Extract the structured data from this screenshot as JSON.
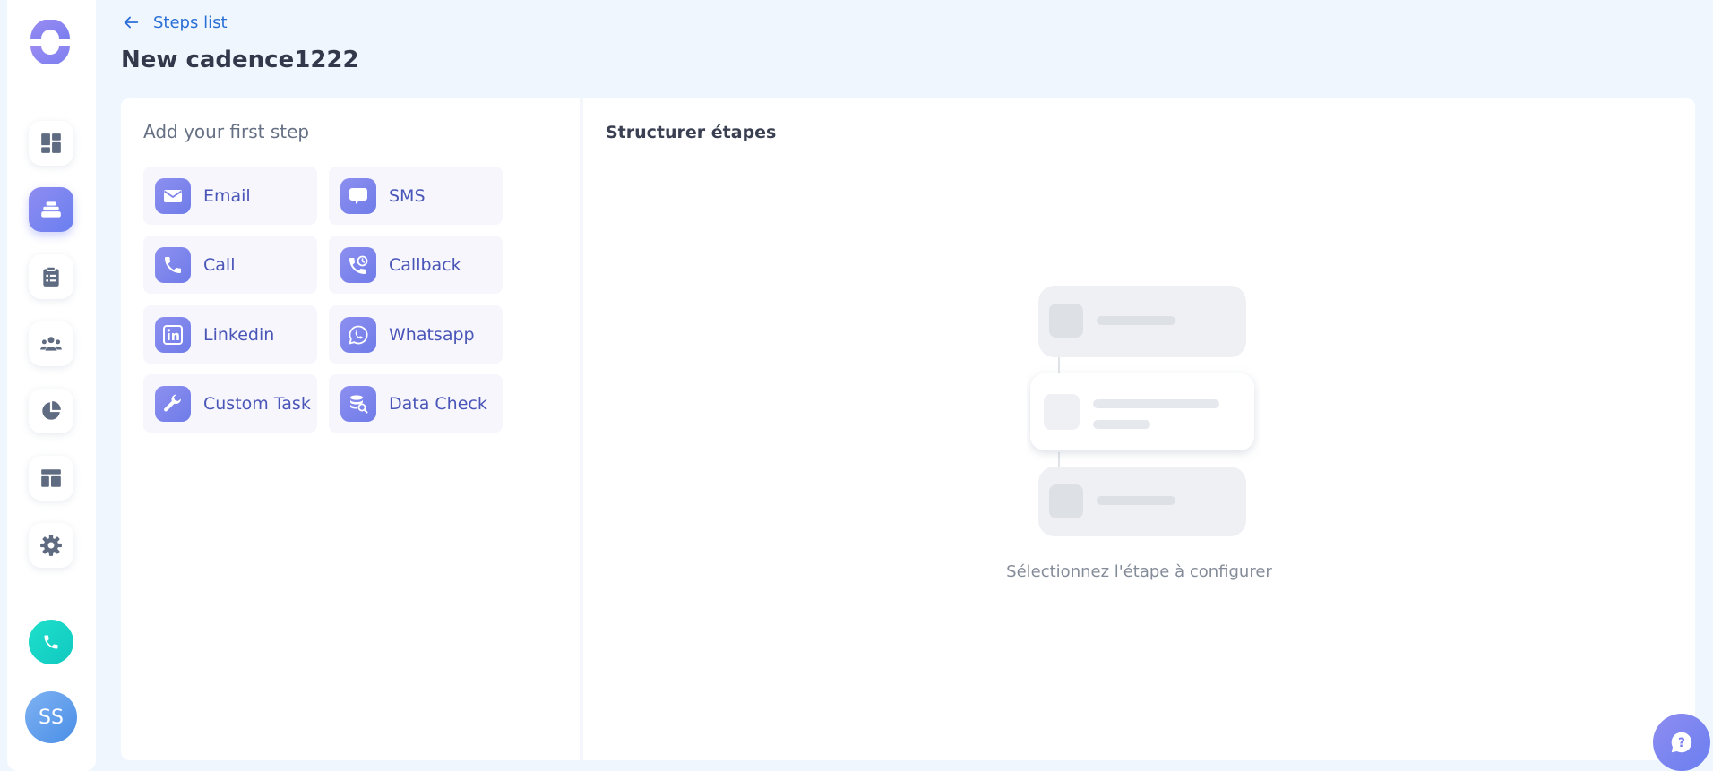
{
  "nav": {
    "back_label": "Steps list",
    "page_title": "New cadence1222"
  },
  "sidebar": {
    "items": [
      {
        "name": "dashboard-icon"
      },
      {
        "name": "cadences-icon",
        "active": true
      },
      {
        "name": "tasks-icon"
      },
      {
        "name": "team-icon"
      },
      {
        "name": "analytics-icon"
      },
      {
        "name": "templates-icon"
      },
      {
        "name": "settings-icon"
      }
    ],
    "avatar_initials": "SS"
  },
  "steps_panel": {
    "heading": "Add your first step",
    "steps": [
      {
        "label": "Email",
        "icon": "email-icon"
      },
      {
        "label": "SMS",
        "icon": "sms-icon"
      },
      {
        "label": "Call",
        "icon": "call-icon"
      },
      {
        "label": "Callback",
        "icon": "callback-icon"
      },
      {
        "label": "Linkedin",
        "icon": "linkedin-icon"
      },
      {
        "label": "Whatsapp",
        "icon": "whatsapp-icon"
      },
      {
        "label": "Custom Task",
        "icon": "wrench-icon"
      },
      {
        "label": "Data Check",
        "icon": "database-search-icon"
      }
    ]
  },
  "structure_panel": {
    "heading": "Structurer étapes",
    "empty_state": "Sélectionnez l'étape à configurer"
  },
  "colors": {
    "accent": "#6a7ff0",
    "phone": "#10c8c0",
    "link": "#2a6fd6",
    "background": "#f0f6fd"
  }
}
